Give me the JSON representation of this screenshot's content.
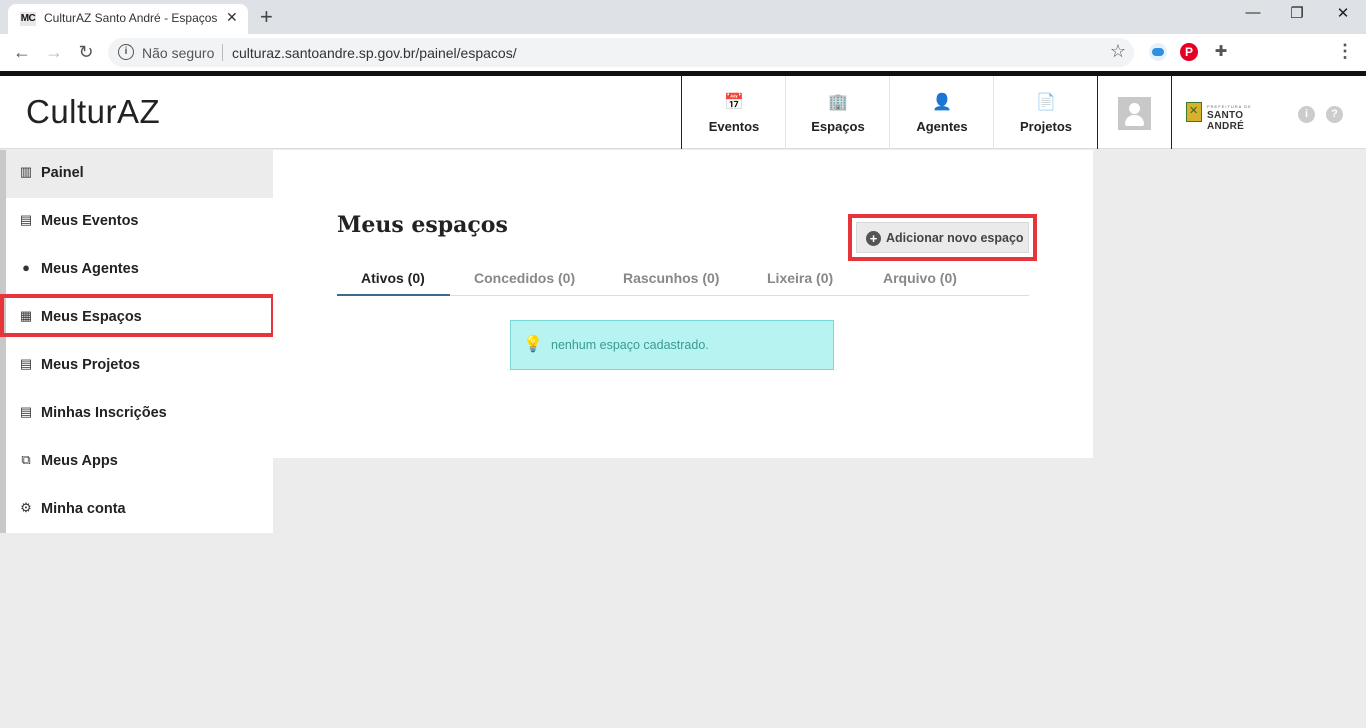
{
  "browser": {
    "tab": {
      "favicon": "MC",
      "title": "CulturAZ Santo André - Espaços",
      "close": "✕"
    },
    "new_tab": "+",
    "window_controls": {
      "minimize": "—",
      "restore": "❐",
      "close": "✕"
    },
    "nav": {
      "back": "←",
      "forward": "→",
      "reload": "↻"
    },
    "omnibox": {
      "info": "i",
      "security": "Não seguro",
      "url": "culturaz.santoandre.sp.gov.br/painel/espacos/",
      "star": "☆"
    },
    "extensions": {
      "pinterest": "P",
      "puzzle": "✚"
    },
    "menu": "⋮"
  },
  "header": {
    "logo": "CulturAZ",
    "nav": [
      {
        "label": "Eventos",
        "icon": "calendar-icon",
        "glyph": "📅"
      },
      {
        "label": "Espaços",
        "icon": "building-icon",
        "glyph": "🏢"
      },
      {
        "label": "Agentes",
        "icon": "person-icon",
        "glyph": "👤"
      },
      {
        "label": "Projetos",
        "icon": "document-icon",
        "glyph": "📄"
      }
    ],
    "prefeitura": {
      "small": "PREFEITURA DE",
      "name": "SANTO ANDRÉ"
    },
    "info_icon": "i",
    "help_icon": "?"
  },
  "sidebar": {
    "items": [
      {
        "label": "Painel",
        "icon": "chart-icon",
        "glyph": "▥"
      },
      {
        "label": "Meus Eventos",
        "icon": "calendar-icon",
        "glyph": "▤"
      },
      {
        "label": "Meus Agentes",
        "icon": "person-icon",
        "glyph": "●"
      },
      {
        "label": "Meus Espaços",
        "icon": "building-icon",
        "glyph": "▦"
      },
      {
        "label": "Meus Projetos",
        "icon": "document-icon",
        "glyph": "▤"
      },
      {
        "label": "Minhas Inscrições",
        "icon": "document-icon",
        "glyph": "▤"
      },
      {
        "label": "Meus Apps",
        "icon": "apps-icon",
        "glyph": "⧉"
      },
      {
        "label": "Minha conta",
        "icon": "gears-icon",
        "glyph": "⚙"
      }
    ]
  },
  "main": {
    "title": "Meus espaços",
    "add_button": {
      "icon": "+",
      "label": "Adicionar novo espaço"
    },
    "tabs": [
      {
        "label": "Ativos (0)"
      },
      {
        "label": "Concedidos (0)"
      },
      {
        "label": "Rascunhos (0)"
      },
      {
        "label": "Lixeira (0)"
      },
      {
        "label": "Arquivo (0)"
      }
    ],
    "notice": {
      "icon": "lightbulb-icon",
      "glyph": "💡",
      "text": "nenhum espaço cadastrado."
    }
  }
}
